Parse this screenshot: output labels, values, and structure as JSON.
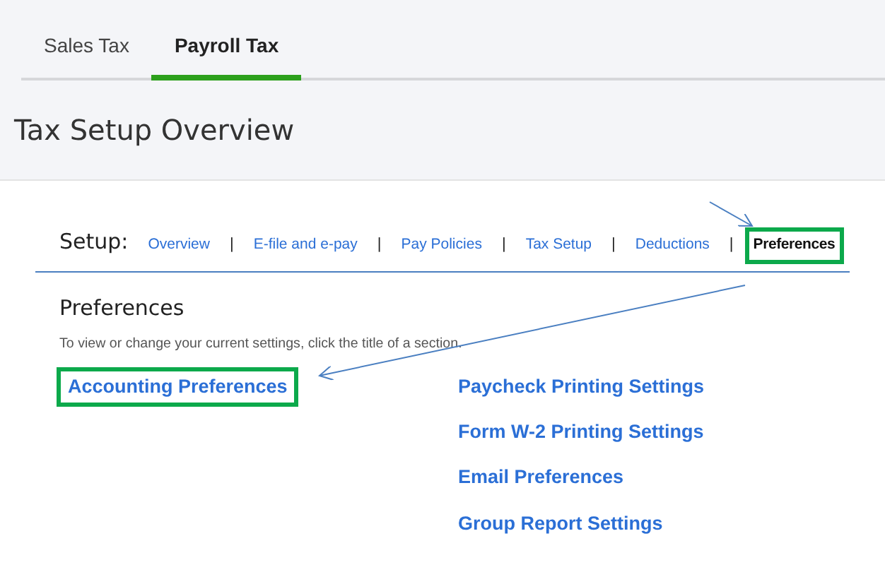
{
  "tabs": [
    {
      "label": "Sales Tax",
      "selected": false
    },
    {
      "label": "Payroll Tax",
      "selected": true
    }
  ],
  "title": "Tax Setup Overview",
  "setup": {
    "label": "Setup:",
    "links": [
      {
        "label": "Overview",
        "selected": false,
        "highlighted": false
      },
      {
        "label": "E-file and e-pay",
        "selected": false,
        "highlighted": false
      },
      {
        "label": "Pay Policies",
        "selected": false,
        "highlighted": false
      },
      {
        "label": "Tax Setup",
        "selected": false,
        "highlighted": false
      },
      {
        "label": "Deductions",
        "selected": false,
        "highlighted": false
      },
      {
        "label": "Preferences",
        "selected": true,
        "highlighted": true
      }
    ],
    "separator": "|"
  },
  "section": {
    "heading": "Preferences",
    "description": "To view or change your current settings, click the title of a section.",
    "columns": [
      [
        {
          "label": "Accounting Preferences",
          "highlighted": true
        }
      ],
      [
        {
          "label": "Paycheck Printing Settings",
          "highlighted": false
        },
        {
          "label": "Form W-2 Printing Settings",
          "highlighted": false
        },
        {
          "label": "Email Preferences",
          "highlighted": false
        },
        {
          "label": "Group Report Settings",
          "highlighted": false
        }
      ]
    ]
  }
}
